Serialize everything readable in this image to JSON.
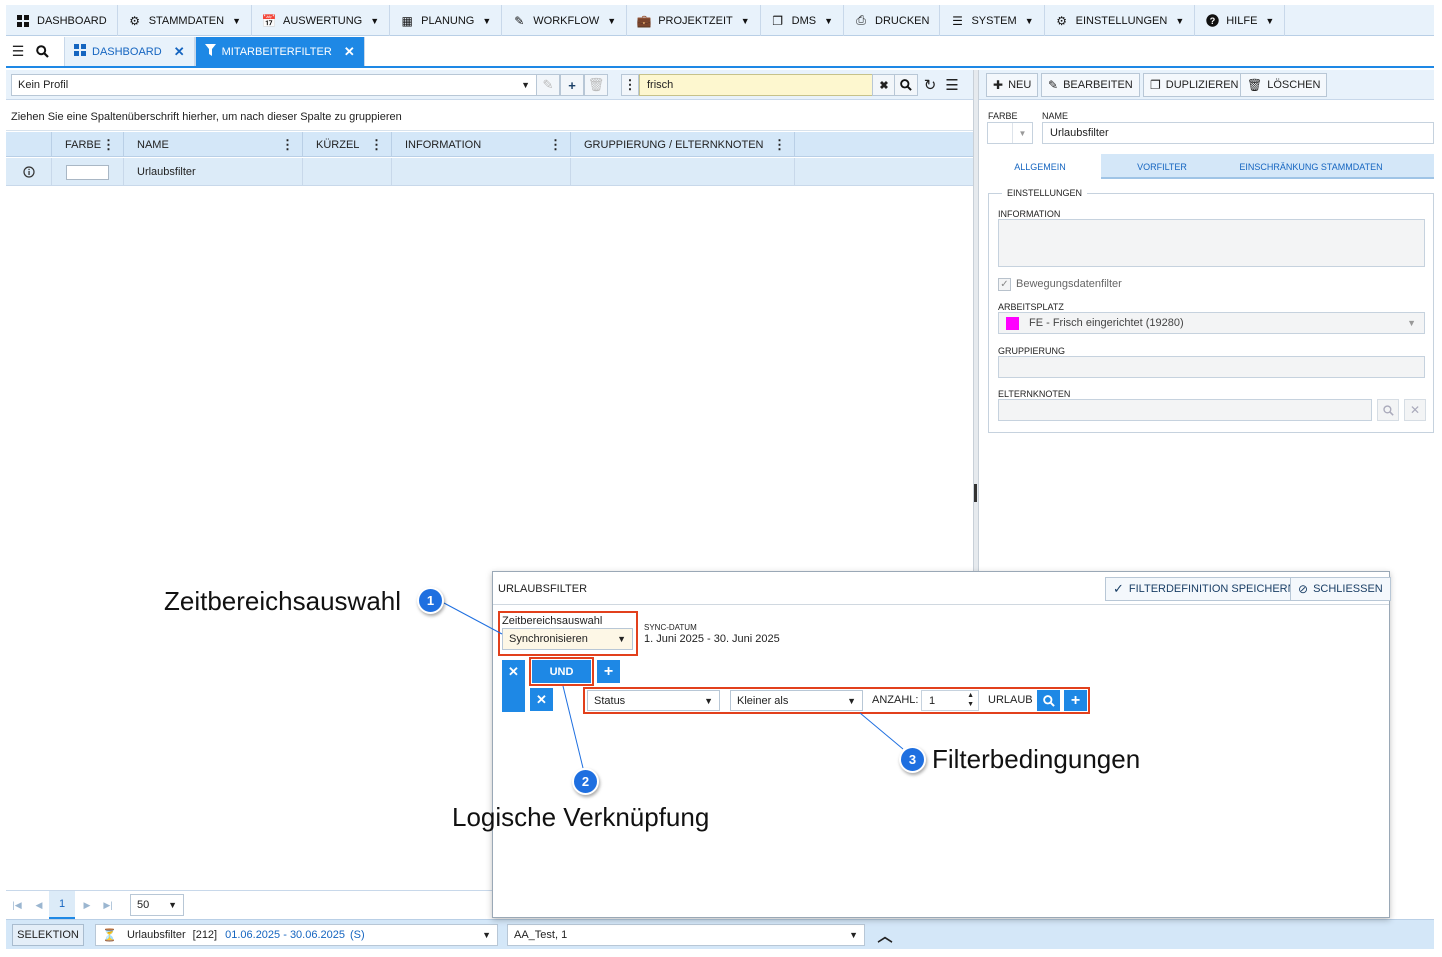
{
  "menu": [
    {
      "label": "DASHBOARD",
      "icon": "dashboard-icon",
      "caret": false
    },
    {
      "label": "STAMMDATEN",
      "icon": "gears-icon",
      "caret": true
    },
    {
      "label": "AUSWERTUNG",
      "icon": "calendar-icon",
      "caret": true
    },
    {
      "label": "PLANUNG",
      "icon": "calendar-grid-icon",
      "caret": true
    },
    {
      "label": "WORKFLOW",
      "icon": "pencil-icon",
      "caret": true
    },
    {
      "label": "PROJEKTZEIT",
      "icon": "briefcase-icon",
      "caret": true
    },
    {
      "label": "DMS",
      "icon": "documents-icon",
      "caret": true
    },
    {
      "label": "DRUCKEN",
      "icon": "printer-icon",
      "caret": false
    },
    {
      "label": "SYSTEM",
      "icon": "server-icon",
      "caret": true
    },
    {
      "label": "EINSTELLUNGEN",
      "icon": "gear-icon",
      "caret": true
    },
    {
      "label": "HILFE",
      "icon": "help-icon",
      "caret": true
    }
  ],
  "tabs": {
    "dashboard": "DASHBOARD",
    "filter": "MITARBEITERFILTER"
  },
  "left": {
    "profile": "Kein Profil",
    "search_value": "frisch",
    "group_hint": "Ziehen Sie eine Spaltenüberschrift hierher, um nach dieser Spalte zu gruppieren",
    "columns": [
      "FARBE",
      "NAME",
      "KÜRZEL",
      "INFORMATION",
      "GRUPPIERUNG / ELTERNKNOTEN"
    ],
    "row": {
      "name": "Urlaubsfilter",
      "kuerzel": "",
      "information": "",
      "gruppierung": ""
    },
    "pager": {
      "page": "1",
      "size": "50"
    }
  },
  "status": {
    "selektion": "SELEKTION",
    "filter_name": "Urlaubsfilter",
    "filter_count": "[212]",
    "filter_range": "01.06.2025 - 30.06.2025",
    "filter_flag": "(S)",
    "user": "AA_Test, 1"
  },
  "right": {
    "buttons": {
      "neu": "NEU",
      "bearbeiten": "BEARBEITEN",
      "duplizieren": "DUPLIZIEREN",
      "loeschen": "LÖSCHEN"
    },
    "farbe_label": "FARBE",
    "name_label": "NAME",
    "name_value": "Urlaubsfilter",
    "tabs": [
      "ALLGEMEIN",
      "VORFILTER",
      "EINSCHRÄNKUNG STAMMDATEN"
    ],
    "einstellungen": "EINSTELLUNGEN",
    "information_label": "INFORMATION",
    "bewegung": "Bewegungsdatenfilter",
    "arbeitsplatz_label": "ARBEITSPLATZ",
    "arbeitsplatz_value": "FE - Frisch eingerichtet (19280)",
    "arbeitsplatz_color": "#ff00ff",
    "gruppierung_label": "GRUPPIERUNG",
    "elternknoten_label": "ELTERNKNOTEN"
  },
  "dialog": {
    "title": "URLAUBSFILTER",
    "save": "FILTERDEFINITION SPEICHERN",
    "close": "SCHLIESSEN",
    "zeit_label": "Zeitbereichsauswahl",
    "zeit_value": "Synchronisieren",
    "sync_label": "SYNC-DATUM",
    "sync_value": "1. Juni 2025 - 30. Juni 2025",
    "und": "UND",
    "cond_field": "Status",
    "cond_op": "Kleiner als",
    "anzahl_label": "ANZAHL:",
    "anzahl_value": "1",
    "urlaub": "URLAUB"
  },
  "annotations": {
    "a1": "Zeitbereichsauswahl",
    "a2": "Logische Verknüpfung",
    "a3": "Filterbedingungen",
    "n1": "1",
    "n2": "2",
    "n3": "3"
  },
  "colors": {
    "accent": "#1e88e5",
    "highlight": "#e2401c",
    "badge": "#1e6fe0"
  }
}
